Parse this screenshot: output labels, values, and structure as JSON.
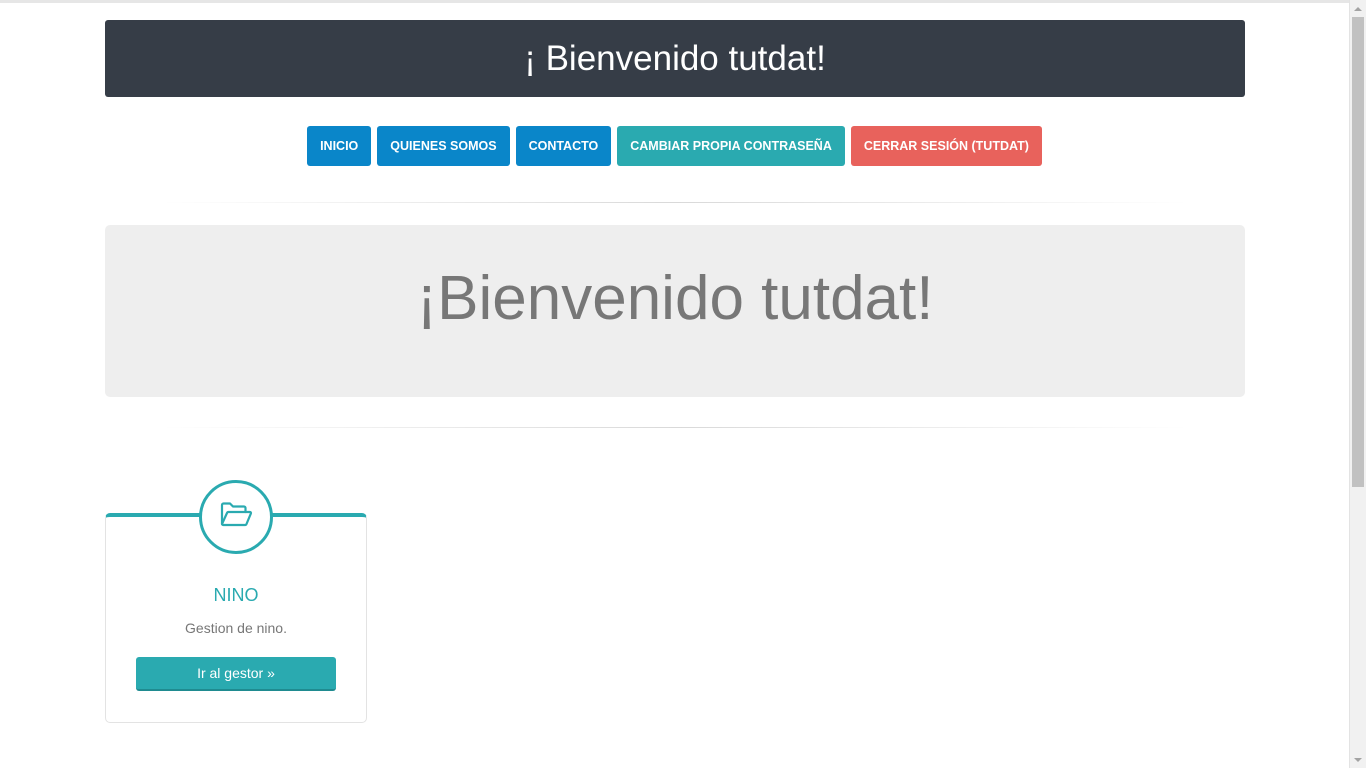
{
  "header": {
    "title": "¡ Bienvenido tutdat!"
  },
  "nav": {
    "items": [
      {
        "label": "INICIO",
        "color": "#0a86c9"
      },
      {
        "label": "QUIENES SOMOS",
        "color": "#0a86c9"
      },
      {
        "label": "CONTACTO",
        "color": "#0a86c9"
      },
      {
        "label": "CAMBIAR PROPIA CONTRASEÑA",
        "color": "#2aaab0"
      },
      {
        "label": "CERRAR SESIÓN (TUTDAT)",
        "color": "#e8625c"
      }
    ]
  },
  "jumbotron": {
    "title": "¡Bienvenido tutdat!"
  },
  "card": {
    "icon": "folder-open-icon",
    "title": "NINO",
    "description": "Gestion de nino.",
    "button_label": "Ir al gestor »",
    "accent": "#2aaab0"
  }
}
